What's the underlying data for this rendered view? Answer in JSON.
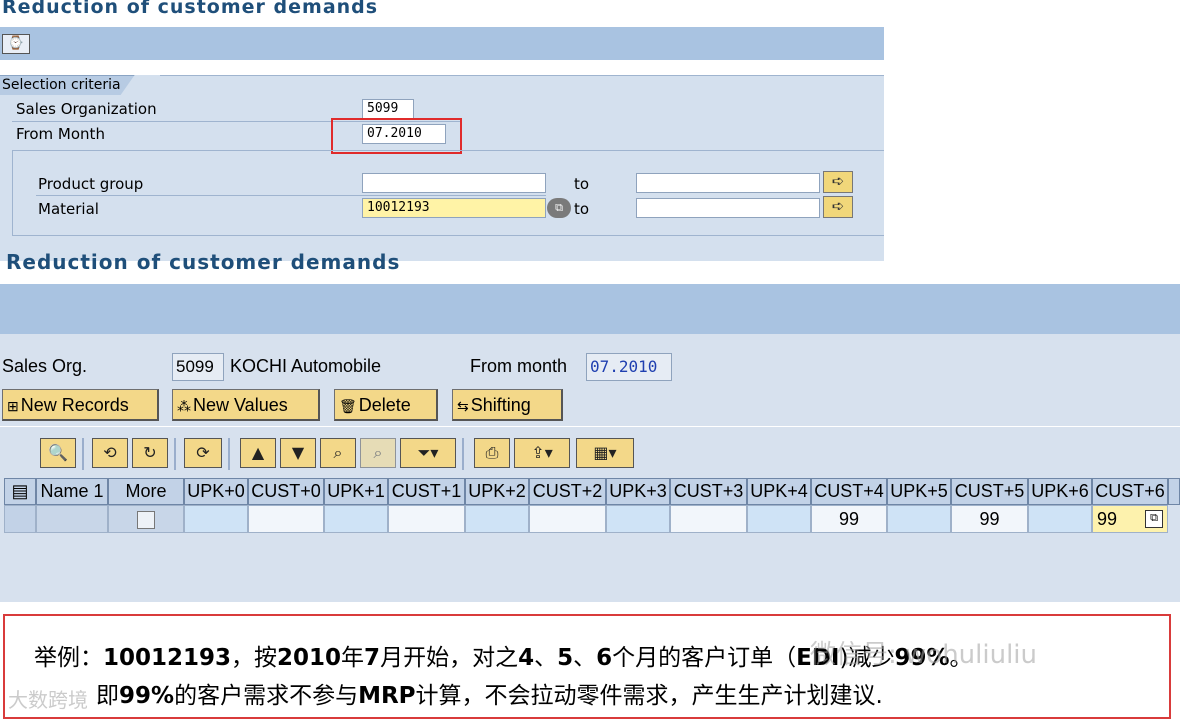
{
  "top_window": {
    "title": "Reduction of customer demands",
    "execute_icon": "execute-clock-icon",
    "section_tab": "Selection criteria",
    "fields": {
      "sales_org_label": "Sales Organization",
      "sales_org_value": "5099",
      "from_month_label": "From Month",
      "from_month_value": "07.2010",
      "product_group_label": "Product group",
      "product_group_value": "",
      "product_group_to_label": "to",
      "product_group_to_value": "",
      "material_label": "Material",
      "material_value": "10012193",
      "material_to_label": "to",
      "material_to_value": ""
    },
    "highlight_color": "#e02b2b"
  },
  "second_window": {
    "title": "Reduction of customer demands",
    "sales_org_label": "Sales Org.",
    "sales_org_value": "5099",
    "sales_org_name": "KOCHI Automobile",
    "from_month_label": "From month",
    "from_month_value": "07.2010",
    "buttons": {
      "new_records": "New Records",
      "new_values": "New Values",
      "delete": "Delete",
      "shifting": "Shifting"
    },
    "grid": {
      "headers": [
        "Name 1",
        "More",
        "UPK+0",
        "CUST+0",
        "UPK+1",
        "CUST+1",
        "UPK+2",
        "CUST+2",
        "UPK+3",
        "CUST+3",
        "UPK+4",
        "CUST+4",
        "UPK+5",
        "CUST+5",
        "UPK+6",
        "CUST+6"
      ],
      "row": [
        "",
        "",
        "",
        "",
        "",
        "",
        "",
        "",
        "",
        "",
        "",
        "99",
        "",
        "99",
        "",
        "99"
      ]
    }
  },
  "note": {
    "line1_a": "举例：",
    "line1_b": "10012193",
    "line1_c": "，按",
    "line1_d": "2010",
    "line1_e": "年",
    "line1_f": "7",
    "line1_g": "月开始，对之",
    "line1_h": "4",
    "line1_i": "、",
    "line1_j": "5",
    "line1_k": "、",
    "line1_l": "6",
    "line1_m": "个月的客户订单（",
    "line1_n": "EDI",
    "line1_o": ")减少",
    "line1_p": "99%",
    "line1_q": "。",
    "line2_a": "即",
    "line2_b": "99%",
    "line2_c": "的客户需求不参与",
    "line2_d": "MRP",
    "line2_e": "计算，不会拉动零件需求，产生生产计划建议.",
    "border_color": "#d93b3b"
  },
  "watermarks": {
    "wechat": "微信号: wohuliuliu",
    "brand": "大数跨境"
  }
}
